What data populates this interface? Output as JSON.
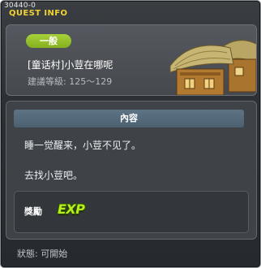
{
  "window": {
    "quest_id": "30440-0",
    "title": "QUEST INFO"
  },
  "header": {
    "category": "一般",
    "quest_name": "[童话村]小荳在哪呢",
    "recommended_level": "建議等級: 125～129",
    "illustration": "thatched-house"
  },
  "content": {
    "section_title": "內容",
    "description": [
      "睡一觉醒来，小荳不见了。",
      "去找小荳吧。"
    ]
  },
  "reward": {
    "label": "獎勵",
    "items": [
      "EXP"
    ]
  },
  "status": {
    "text": "狀態: 可開始"
  },
  "colors": {
    "title_yellow": "#f2d233",
    "badge_green": "#96c22b",
    "exp_green": "#b5f01c",
    "section_header": "#566c7d"
  }
}
